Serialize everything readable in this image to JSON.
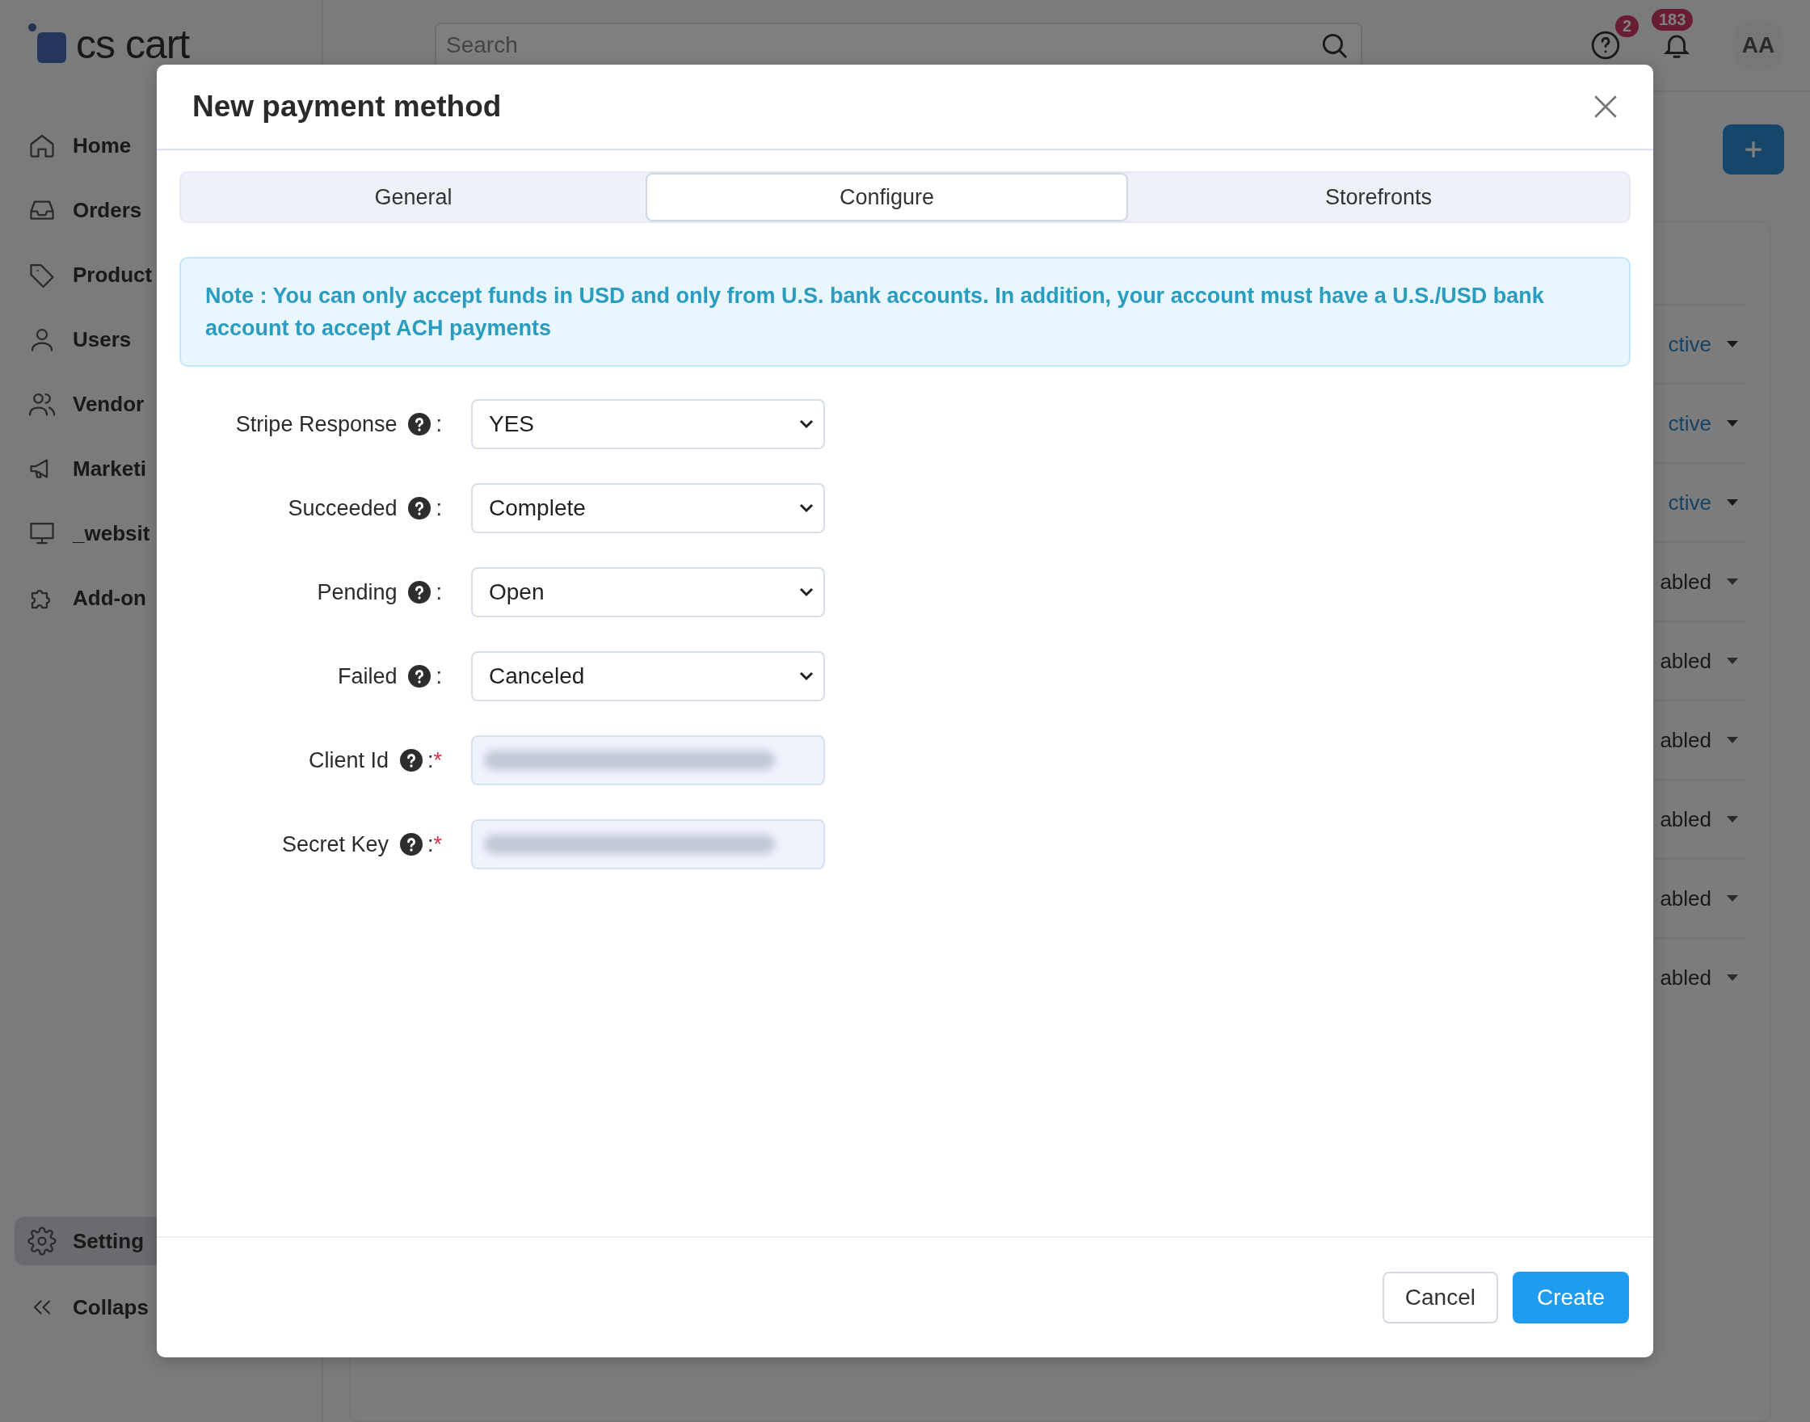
{
  "brand": {
    "logo_text": "cs cart"
  },
  "sidebar": {
    "items": [
      {
        "label": "Home",
        "selected": false
      },
      {
        "label": "Orders",
        "selected": false
      },
      {
        "label": "Product",
        "selected": false
      },
      {
        "label": "Users",
        "selected": false
      },
      {
        "label": "Vendor",
        "selected": false
      },
      {
        "label": "Marketi",
        "selected": false
      },
      {
        "label": "_websit",
        "selected": false
      },
      {
        "label": "Add-on",
        "selected": false
      }
    ],
    "bottom_items": [
      {
        "label": "Setting",
        "selected": true
      },
      {
        "label": "Collaps",
        "selected": false
      }
    ]
  },
  "topbar": {
    "search": {
      "placeholder": "Search"
    },
    "help_badge": "2",
    "notifications_badge": "183",
    "avatar": "AA"
  },
  "background_list": {
    "rows": [
      {
        "status": "ctive",
        "kind": "active"
      },
      {
        "status": "ctive",
        "kind": "active"
      },
      {
        "status": "ctive",
        "kind": "active"
      },
      {
        "status": "abled",
        "kind": "disabled"
      },
      {
        "status": "abled",
        "kind": "disabled"
      },
      {
        "status": "abled",
        "kind": "disabled"
      },
      {
        "status": "abled",
        "kind": "disabled"
      },
      {
        "status": "abled",
        "kind": "disabled"
      },
      {
        "status": "abled",
        "kind": "disabled"
      }
    ]
  },
  "modal": {
    "title": "New payment method",
    "tabs": [
      {
        "label": "General",
        "selected": false
      },
      {
        "label": "Configure",
        "selected": true
      },
      {
        "label": "Storefronts",
        "selected": false
      }
    ],
    "note": "Note : You can only accept funds in USD and only from U.S. bank accounts. In addition, your account must have a U.S./USD bank account to accept ACH payments",
    "fields": [
      {
        "label": "Stripe Response",
        "separator": ":",
        "kind": "select",
        "value": "YES"
      },
      {
        "label": "Succeeded",
        "separator": ":",
        "kind": "select",
        "value": "Complete"
      },
      {
        "label": "Pending",
        "separator": ":",
        "kind": "select",
        "value": "Open"
      },
      {
        "label": "Failed",
        "separator": ":",
        "kind": "select",
        "value": "Canceled"
      },
      {
        "label": "Client Id",
        "separator": ":",
        "required_mark": "*",
        "kind": "secret"
      },
      {
        "label": "Secret Key",
        "separator": ":",
        "required_mark": "*",
        "kind": "secret"
      }
    ],
    "buttons": [
      {
        "label": "Cancel",
        "kind": "secondary"
      },
      {
        "label": "Create",
        "kind": "primary"
      }
    ]
  }
}
